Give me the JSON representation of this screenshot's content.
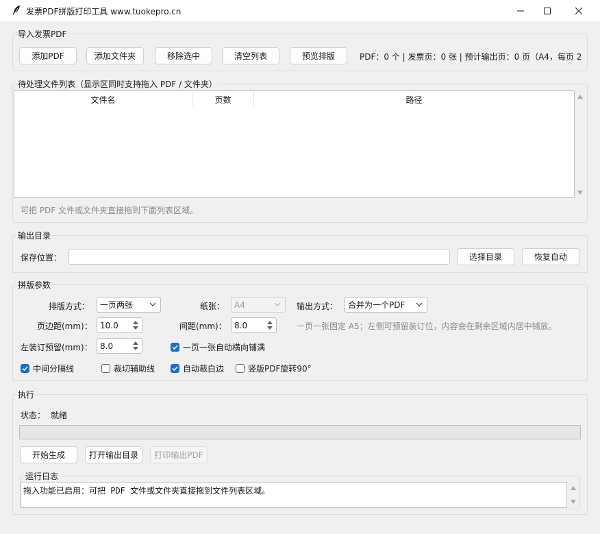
{
  "window": {
    "title": "发票PDF拼版打印工具 www.tuokepro.cn",
    "icon": "feather-icon"
  },
  "import_section": {
    "title": "导入发票PDF",
    "buttons": {
      "add_pdf": "添加PDF",
      "add_folder": "添加文件夹",
      "remove_selected": "移除选中",
      "clear_list": "清空列表",
      "preview_layout": "预览排版"
    },
    "stats": "PDF：0 个 | 发票页：0 张 | 预计输出页：0 页（A4，每页 2"
  },
  "file_list_section": {
    "title": "待处理文件列表（显示区同时支持拖入 PDF / 文件夹）",
    "columns": [
      "文件名",
      "页数",
      "路径"
    ],
    "rows": [],
    "hint": "可把 PDF 文件或文件夹直接拖到下面列表区域。"
  },
  "output_section": {
    "title": "输出目录",
    "save_label": "保存位置：",
    "save_path": "",
    "choose_dir": "选择目录",
    "restore_auto": "恢复自动"
  },
  "layout_section": {
    "title": "拼版参数",
    "layout_mode_label": "排版方式：",
    "layout_mode_value": "一页两张",
    "paper_label": "纸张：",
    "paper_value": "A4",
    "output_mode_label": "输出方式：",
    "output_mode_value": "合并为一个PDF",
    "margin_label": "页边距(mm)：",
    "margin_value": "10.0",
    "gap_label": "间距(mm)：",
    "gap_value": "8.0",
    "note": "一页一张固定 A5；左侧可预留装订位，内容会在剩余区域内居中铺放。",
    "binding_label": "左装订预留(mm)：",
    "binding_value": "8.0",
    "check_fill": {
      "label": "一页一张自动横向铺满",
      "checked": true
    },
    "check_divider": {
      "label": "中间分隔线",
      "checked": true
    },
    "check_cut": {
      "label": "裁切辅助线",
      "checked": false
    },
    "check_trim": {
      "label": "自动裁白边",
      "checked": true
    },
    "check_rotate": {
      "label": "竖版PDF旋转90°",
      "checked": false
    }
  },
  "execute_section": {
    "title": "执行",
    "status_label": "状态：",
    "status_value": "就绪",
    "progress": 0,
    "start": "开始生成",
    "open_output": "打开输出目录",
    "print_output": "打印输出PDF",
    "log_title": "运行日志",
    "log_text": "拖入功能已启用：可把 PDF 文件或文件夹直接拖到文件列表区域。"
  },
  "colors": {
    "checkbox_on": "#1a6fc9",
    "window_bg": "#f0f0f0"
  }
}
